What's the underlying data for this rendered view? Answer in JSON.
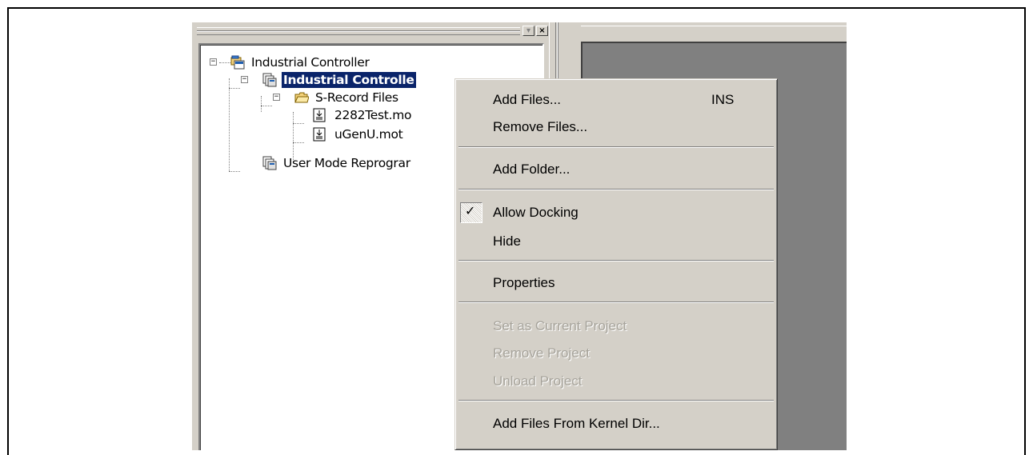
{
  "tree": {
    "nodes": [
      {
        "label": "Industrial Controller",
        "icon": "workspace-icon"
      },
      {
        "label": "Industrial Controlle",
        "icon": "project-icon",
        "selected": true
      },
      {
        "label": "S-Record Files",
        "icon": "folder-icon"
      },
      {
        "label": "2282Test.mo",
        "icon": "s-record-file-icon"
      },
      {
        "label": "uGenU.mot",
        "icon": "s-record-file-icon"
      },
      {
        "label": "User Mode Reprograr",
        "icon": "project-icon"
      }
    ]
  },
  "title_buttons": {
    "minimize": "▾",
    "close": "×"
  },
  "context_menu": {
    "items": [
      {
        "label": "Add Files...",
        "shortcut": "INS"
      },
      {
        "label": "Remove Files..."
      },
      {
        "label": "Add Folder..."
      },
      {
        "label": "Allow Docking",
        "checked": true
      },
      {
        "label": "Hide"
      },
      {
        "label": "Properties"
      },
      {
        "label": "Set as Current Project",
        "disabled": true
      },
      {
        "label": "Remove Project",
        "disabled": true
      },
      {
        "label": "Unload Project",
        "disabled": true
      },
      {
        "label": "Add Files From Kernel Dir..."
      }
    ],
    "check_mark": "✓"
  },
  "colors": {
    "face": "#d4d0c8",
    "selection": "#0a246a",
    "dock_area": "#808080",
    "disabled_text": "#a7a49c"
  }
}
